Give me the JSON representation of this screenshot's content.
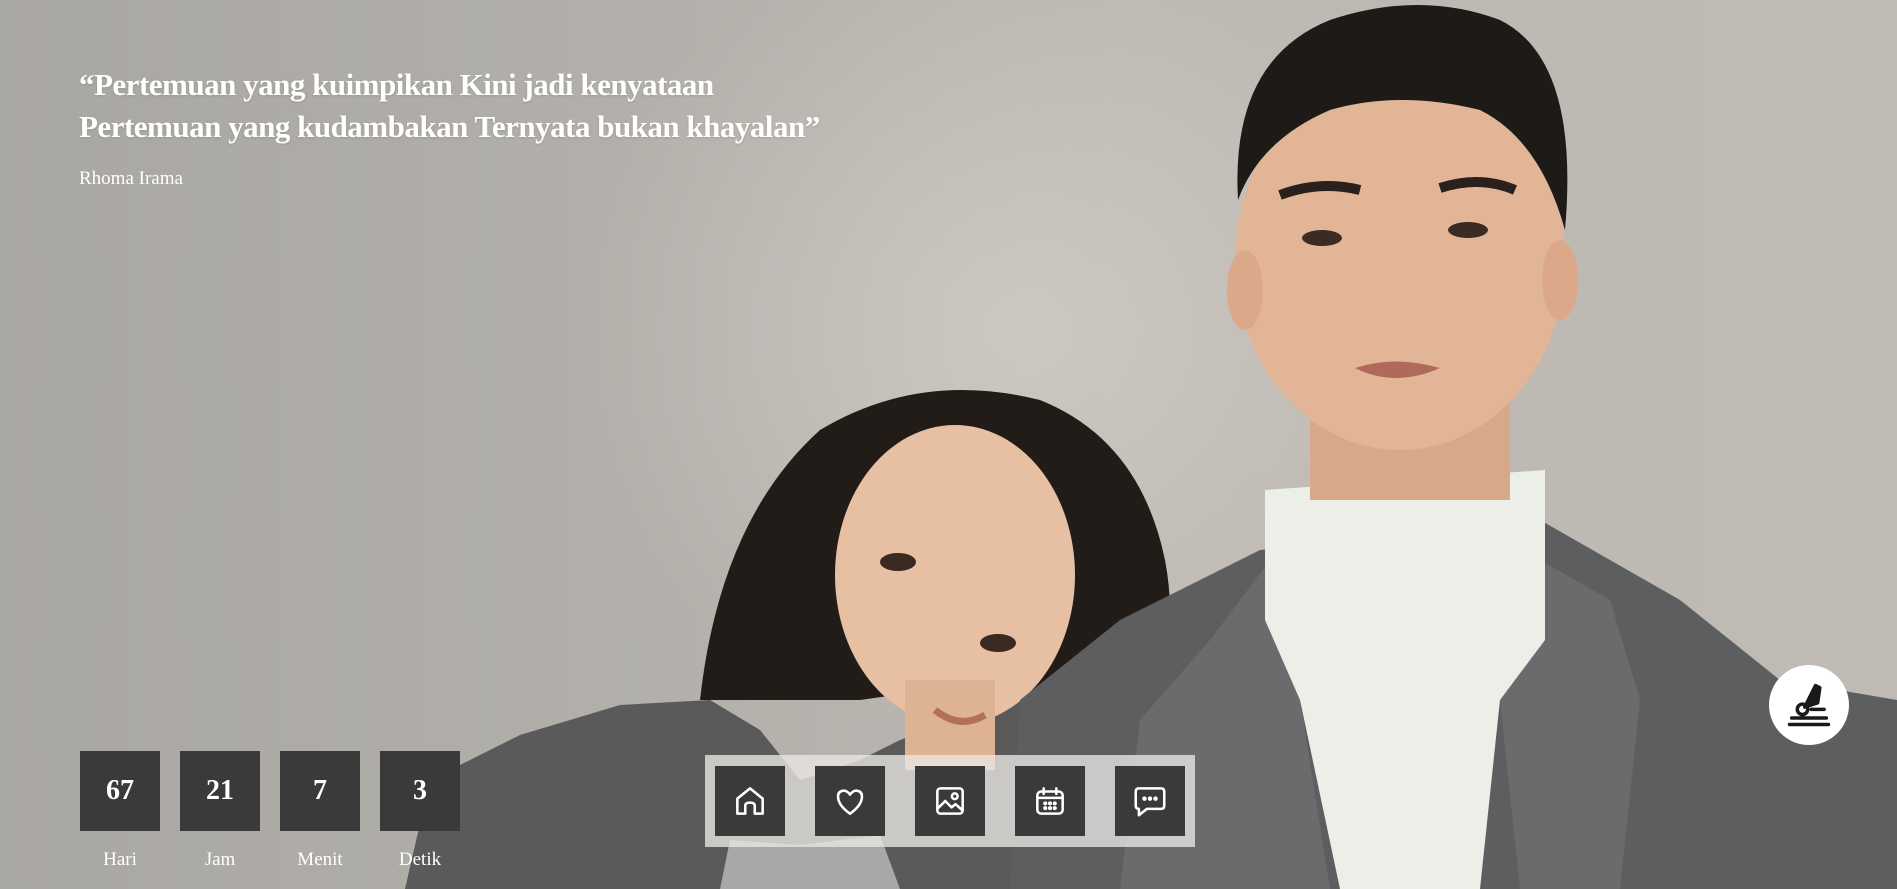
{
  "quote": {
    "line1": "“Pertemuan yang kuimpikan Kini jadi kenyataan",
    "line2": "Pertemuan yang kudambakan Ternyata bukan khayalan”",
    "author": "Rhoma Irama"
  },
  "countdown": [
    {
      "value": "67",
      "label": "Hari"
    },
    {
      "value": "21",
      "label": "Jam"
    },
    {
      "value": "7",
      "label": "Menit"
    },
    {
      "value": "3",
      "label": "Detik"
    }
  ],
  "nav": {
    "icons": [
      "home-icon",
      "heart-icon",
      "image-icon",
      "calendar-icon",
      "chat-bubble-icon"
    ]
  },
  "music": {
    "icon": "gramophone-icon"
  },
  "colors": {
    "background": "#b3b0ab",
    "box": "#3a3a3a",
    "text": "#ffffff",
    "nav_bar": "#ebe8e4"
  }
}
